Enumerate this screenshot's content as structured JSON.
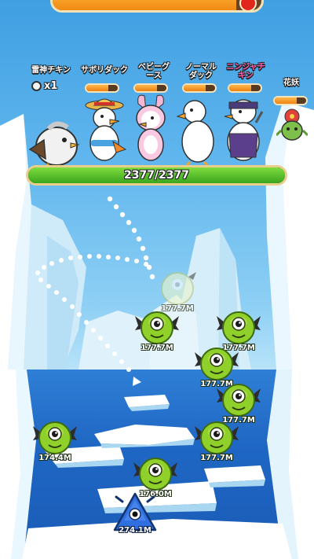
{
  "top_gauge": {
    "progress": 0.88
  },
  "party": [
    {
      "name": "雷神チキン",
      "color": "white",
      "gauge": null
    },
    {
      "name": "サボリダック",
      "color": "white",
      "gauge": 0.7
    },
    {
      "name": "ベビーグース",
      "color": "white",
      "gauge": 0.7
    },
    {
      "name": "ノーマルダック",
      "color": "white",
      "gauge": 0.7
    },
    {
      "name": "ニンジャチキン",
      "color": "pink",
      "gauge": 0.7
    },
    {
      "name": "花妖",
      "color": "white",
      "gauge": 0.7
    }
  ],
  "ball_counter": {
    "label": "x1"
  },
  "boss_hp": {
    "text": "2377/2377",
    "current": 2377,
    "max": 2377
  },
  "enemies": [
    {
      "id": "faded",
      "value": "177.7M"
    },
    {
      "id": "e1",
      "value": "177.7M"
    },
    {
      "id": "e2",
      "value": "177.7M"
    },
    {
      "id": "e3",
      "value": "177.7M"
    },
    {
      "id": "e4",
      "value": "177.7M"
    },
    {
      "id": "e5",
      "value": "177.7M"
    },
    {
      "id": "e6",
      "value": "174.4M"
    },
    {
      "id": "e7",
      "value": "176.0M"
    }
  ],
  "shooter": {
    "value": "274.1M"
  },
  "colors": {
    "hp_fill": "#3aa51e",
    "gauge_fill": "#f08a12",
    "enemy_green": "#8fd12a",
    "shooter_blue": "#2f6fe0"
  }
}
